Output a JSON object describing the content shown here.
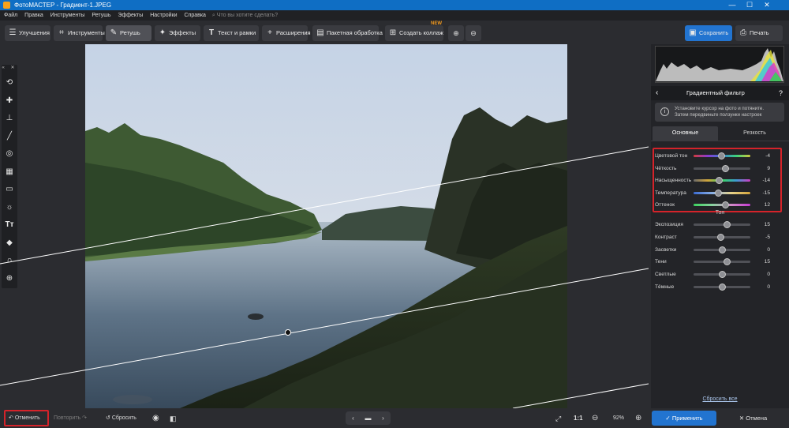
{
  "window": {
    "title": "ФотоМАСТЕР - Градиент-1.JPEG",
    "minimize": "—",
    "maximize": "☐",
    "close": "✕"
  },
  "menu": {
    "items": [
      "Файл",
      "Правка",
      "Инструменты",
      "Ретушь",
      "Эффекты",
      "Настройки",
      "Справка"
    ],
    "search_placeholder": "Что вы хотите сделать?"
  },
  "toolbar": {
    "tabs": [
      {
        "label": "Улучшения",
        "icon": "sliders-icon"
      },
      {
        "label": "Инструменты",
        "icon": "crop-icon"
      },
      {
        "label": "Ретушь",
        "icon": "brush-icon"
      },
      {
        "label": "Эффекты",
        "icon": "sparkle-icon"
      },
      {
        "label": "Текст и рамки",
        "icon": "text-icon"
      },
      {
        "label": "Расширения",
        "icon": "plus-icon"
      }
    ],
    "active_tab": "Ретушь",
    "batch_label": "Пакетная обработка",
    "collage_label": "Создать коллаж",
    "collage_badge": "NEW",
    "save_label": "Сохранить",
    "print_label": "Печать"
  },
  "left_tools": [
    "heal-icon",
    "patch-icon",
    "stamp-icon",
    "brush-icon",
    "radial-icon",
    "gradient-icon",
    "vignette-icon",
    "light-icon",
    "text-icon",
    "fill-icon",
    "magnet-icon",
    "globe-icon"
  ],
  "panel": {
    "title": "Градиентный фильтр",
    "back_icon": "chevron-left-icon",
    "help": "?",
    "hint_line1": "Установите курсор на фото и потяните.",
    "hint_line2": "Затем передвиньте ползунки настроек",
    "tabs": [
      "Основные",
      "Резкость"
    ],
    "active_tab": "Основные",
    "color_sliders": [
      {
        "label": "Цветовой тон",
        "value": "-4",
        "pos": 0.48
      },
      {
        "label": "Чёткость",
        "value": "9",
        "pos": 0.55
      },
      {
        "label": "Насыщенность",
        "value": "-14",
        "pos": 0.44
      },
      {
        "label": "Температура",
        "value": "-15",
        "pos": 0.43
      },
      {
        "label": "Оттенок",
        "value": "12",
        "pos": 0.56
      }
    ],
    "tone_title": "Тон",
    "tone_sliders": [
      {
        "label": "Экспозиция",
        "value": "15",
        "pos": 0.58
      },
      {
        "label": "Контраст",
        "value": "-5",
        "pos": 0.47
      },
      {
        "label": "Засветки",
        "value": "0",
        "pos": 0.5
      },
      {
        "label": "Тени",
        "value": "15",
        "pos": 0.58
      },
      {
        "label": "Светлые",
        "value": "0",
        "pos": 0.5
      },
      {
        "label": "Тёмные",
        "value": "0",
        "pos": 0.5
      }
    ],
    "reset_all": "Сбросить все"
  },
  "bottom": {
    "undo_label": "Отменить",
    "redo_label": "Повторить",
    "reset_label": "Сбросить",
    "ratio_label": "1:1",
    "zoom": "92%",
    "apply_label": "Применить",
    "cancel_label": "Отмена"
  },
  "colors": {
    "accent": "#2274d0",
    "highlight": "#d5232a",
    "titlebar": "#0f6ec4"
  }
}
